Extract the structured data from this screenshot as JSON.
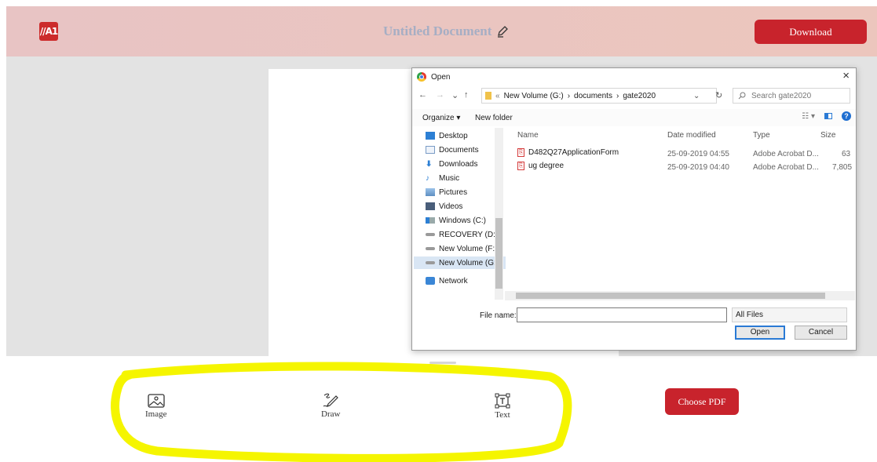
{
  "header": {
    "logo_text": "//A1",
    "document_title": "Untitled Document",
    "download_label": "Download"
  },
  "dialog": {
    "title": "Open",
    "close_symbol": "×",
    "nav": {
      "back_symbol": "←",
      "forward_symbol": "→",
      "recent_symbol": "⌄",
      "up_symbol": "↑",
      "dropdown_symbol": "⌄",
      "refresh_symbol": "↻"
    },
    "address_path": [
      "«",
      "New Volume (G:)",
      "›",
      "documents",
      "›",
      "gate2020"
    ],
    "search_placeholder": "Search gate2020",
    "toolbar": {
      "organize": "Organize ▾",
      "new_folder": "New folder"
    },
    "nav_items": [
      {
        "label": "Desktop",
        "icon": "desktop-icon"
      },
      {
        "label": "Documents",
        "icon": "documents-icon"
      },
      {
        "label": "Downloads",
        "icon": "downloads-icon"
      },
      {
        "label": "Music",
        "icon": "music-icon"
      },
      {
        "label": "Pictures",
        "icon": "pictures-icon"
      },
      {
        "label": "Videos",
        "icon": "videos-icon"
      },
      {
        "label": "Windows (C:)",
        "icon": "drive-icon"
      },
      {
        "label": "RECOVERY (D:)",
        "icon": "drive-icon"
      },
      {
        "label": "New Volume (F:)",
        "icon": "drive-icon"
      },
      {
        "label": "New Volume (G:)",
        "icon": "drive-icon",
        "selected": true
      },
      {
        "label": "Network",
        "icon": "network-icon"
      }
    ],
    "columns": {
      "name": "Name",
      "date_modified": "Date modified",
      "type": "Type",
      "size": "Size"
    },
    "files": [
      {
        "name": "D482Q27ApplicationForm",
        "date": "25-09-2019 04:55",
        "type": "Adobe Acrobat D...",
        "size": "63"
      },
      {
        "name": "ug degree",
        "date": "25-09-2019 04:40",
        "type": "Adobe Acrobat D...",
        "size": "7,805"
      }
    ],
    "file_name_label": "File name:",
    "file_name_value": "",
    "file_type_value": "All Files",
    "open_label": "Open",
    "cancel_label": "Cancel"
  },
  "tools": [
    {
      "label": "Image",
      "icon": "image-icon"
    },
    {
      "label": "Draw",
      "icon": "draw-icon"
    },
    {
      "label": "Text",
      "icon": "text-icon"
    }
  ],
  "choose_pdf_label": "Choose PDF",
  "colors": {
    "brand_red": "#c8232c",
    "header_bg": "#e8c4c4",
    "highlight_yellow": "#f5f500"
  }
}
